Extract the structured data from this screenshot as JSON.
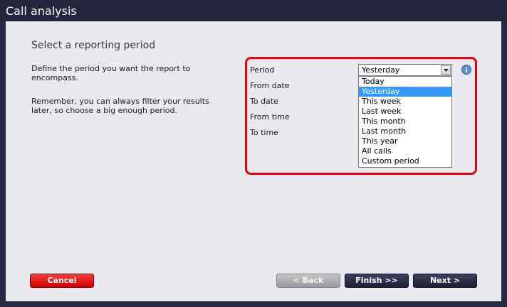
{
  "window": {
    "title": "Call analysis"
  },
  "main": {
    "heading": "Select a reporting period",
    "description": "Define the period you want the report to encompass.",
    "reminder": "Remember, you can always filter your results later, so choose a big enough period."
  },
  "form": {
    "period_label": "Period",
    "from_date_label": "From date",
    "to_date_label": "To date",
    "from_time_label": "From time",
    "to_time_label": "To time",
    "period_value": "Yesterday",
    "period_options": [
      "Today",
      "Yesterday",
      "This week",
      "Last week",
      "This month",
      "Last month",
      "This year",
      "All calls",
      "Custom period"
    ],
    "selected_option": "Yesterday"
  },
  "icons": {
    "info": "info-icon",
    "dropdown": "chevron-down-icon"
  },
  "buttons": {
    "cancel": "Cancel",
    "back": "< Back",
    "finish": "Finish >>",
    "next": "Next >"
  },
  "colors": {
    "highlight": "#e8000e",
    "selection": "#3399ff",
    "cancel": "#e60000",
    "primary": "#23263c",
    "disabled": "#a8a8ac"
  }
}
